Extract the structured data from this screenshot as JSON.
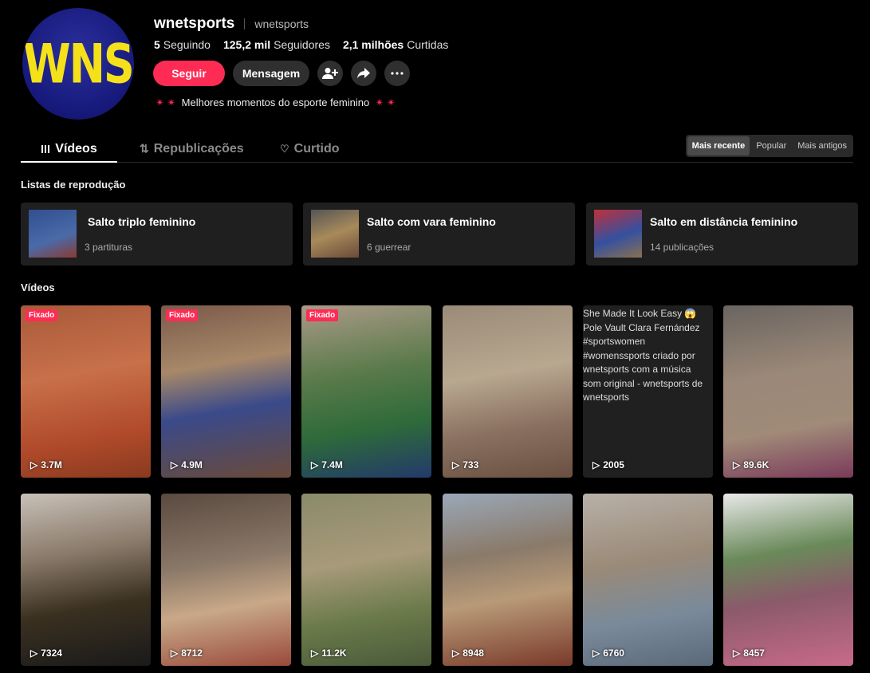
{
  "profile": {
    "avatar_text": "WNS",
    "name": "wnetsports",
    "nickname": "wnetsports",
    "following_count": "5",
    "following_label": "Seguindo",
    "followers_count": "125,2 mil",
    "followers_label": "Seguidores",
    "likes_count": "2,1 milhões",
    "likes_label": "Curtidas",
    "bio": "Melhores momentos do esporte feminino"
  },
  "actions": {
    "follow": "Seguir",
    "message": "Mensagem"
  },
  "tabs": [
    "Vídeos",
    "Republicações",
    "Curtido"
  ],
  "sort": [
    "Mais recente",
    "Popular",
    "Mais antigos"
  ],
  "playlists_title": "Listas de reprodução",
  "playlists": [
    {
      "title": "Salto triplo feminino",
      "sub": "3 partituras"
    },
    {
      "title": "Salto com vara feminino",
      "sub": "6 guerrear"
    },
    {
      "title": "Salto em distância feminino",
      "sub": "14 publicações"
    }
  ],
  "videos_title": "Vídeos",
  "pinned_label": "Fixado",
  "videos": [
    {
      "views": "3.7M"
    },
    {
      "views": "4.9M"
    },
    {
      "views": "7.4M"
    },
    {
      "views": "733"
    },
    {
      "views": "2005",
      "alt": "She Made It Look Easy 😱 Pole Vault Clara Fernández #sportswomen #womenssports criado por wnetsports com a música som original - wnetsports de wnetsports"
    },
    {
      "views": "89.6K"
    },
    {
      "views": "7324"
    },
    {
      "views": "8712"
    },
    {
      "views": "11.2K"
    },
    {
      "views": "8948"
    },
    {
      "views": "6760"
    },
    {
      "views": "8457"
    }
  ],
  "colors": {
    "accent": "#fe2c55",
    "background": "#000000",
    "surface": "#1f1f1f"
  }
}
